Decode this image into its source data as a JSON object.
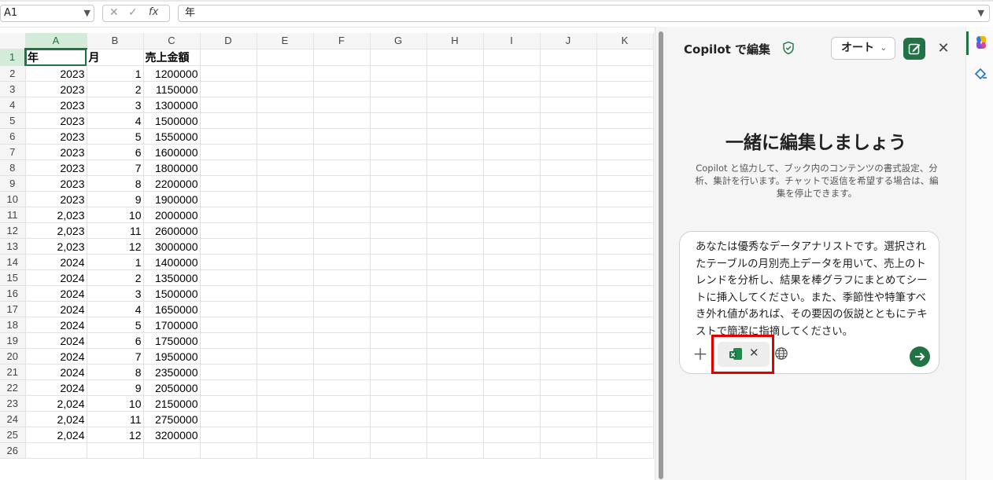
{
  "formula_bar": {
    "name_box": "A1",
    "formula_value": "年"
  },
  "columns": [
    "A",
    "B",
    "C",
    "D",
    "E",
    "F",
    "G",
    "H",
    "I",
    "J",
    "K"
  ],
  "rows": [
    [
      "年",
      "月",
      "売上金額"
    ],
    [
      "2023",
      "1",
      "1200000"
    ],
    [
      "2023",
      "2",
      "1150000"
    ],
    [
      "2023",
      "3",
      "1300000"
    ],
    [
      "2023",
      "4",
      "1500000"
    ],
    [
      "2023",
      "5",
      "1550000"
    ],
    [
      "2023",
      "6",
      "1600000"
    ],
    [
      "2023",
      "7",
      "1800000"
    ],
    [
      "2023",
      "8",
      "2200000"
    ],
    [
      "2023",
      "9",
      "1900000"
    ],
    [
      "2,023",
      "10",
      "2000000"
    ],
    [
      "2,023",
      "11",
      "2600000"
    ],
    [
      "2,023",
      "12",
      "3000000"
    ],
    [
      "2024",
      "1",
      "1400000"
    ],
    [
      "2024",
      "2",
      "1350000"
    ],
    [
      "2024",
      "3",
      "1500000"
    ],
    [
      "2024",
      "4",
      "1650000"
    ],
    [
      "2024",
      "5",
      "1700000"
    ],
    [
      "2024",
      "6",
      "1750000"
    ],
    [
      "2024",
      "7",
      "1950000"
    ],
    [
      "2024",
      "8",
      "2350000"
    ],
    [
      "2024",
      "9",
      "2050000"
    ],
    [
      "2,024",
      "10",
      "2150000"
    ],
    [
      "2,024",
      "11",
      "2750000"
    ],
    [
      "2,024",
      "12",
      "3200000"
    ],
    [
      "",
      "",
      ""
    ]
  ],
  "copilot": {
    "title": "Copilot で編集",
    "mode_label": "オート",
    "heading": "一緒に編集しましょう",
    "description": "Copilot と協力して、ブック内のコンテンツの書式設定、分析、集計を行います。チャットで返信を希望する場合は、編集を停止できます。",
    "prompt": "あなたは優秀なデータアナリストです。選択されたテーブルの月別売上データを用いて、売上のトレンドを分析し、結果を棒グラフにまとめてシートに挿入してください。また、季節性や特筆すべき外れ値があれば、その要因の仮説とともにテキストで簡潔に指摘してください。"
  },
  "colors": {
    "accent": "#217346",
    "highlight": "#e00000"
  }
}
